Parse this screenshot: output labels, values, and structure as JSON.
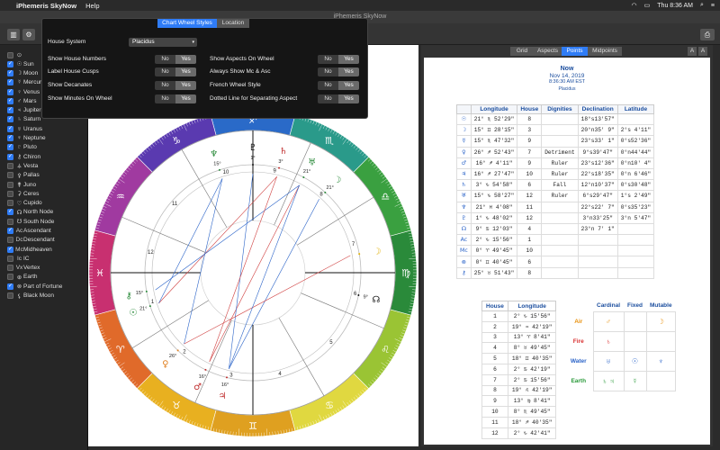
{
  "menubar": {
    "app": "iPhemeris SkyNow",
    "menu": "Help",
    "time": "Thu 8:36 AM"
  },
  "window_title": "iPhemeris SkyNow",
  "popover": {
    "tabs": [
      "Chart Wheel Styles",
      "Location"
    ],
    "house_system_label": "House System",
    "house_system_value": "Placidus",
    "left_options": [
      {
        "label": "Show House Numbers"
      },
      {
        "label": "Label House Cusps"
      },
      {
        "label": "Show Decanates"
      },
      {
        "label": "Show Minutes On Wheel"
      }
    ],
    "right_options": [
      {
        "label": "Show Aspects On Wheel"
      },
      {
        "label": "Always Show Mc & Asc"
      },
      {
        "label": "French Wheel Style"
      },
      {
        "label": "Dotted Line for Separating Aspect"
      }
    ],
    "no": "No",
    "yes": "Yes"
  },
  "sidebar": {
    "items": [
      {
        "sym": "☉",
        "label": "Sun",
        "on": true
      },
      {
        "sym": "☽",
        "label": "Moon",
        "on": true
      },
      {
        "sym": "☿",
        "label": "Mercury",
        "on": true
      },
      {
        "sym": "♀",
        "label": "Venus",
        "on": true
      },
      {
        "sym": "♂",
        "label": "Mars",
        "on": true
      },
      {
        "sym": "♃",
        "label": "Jupiter",
        "on": true
      },
      {
        "sym": "♄",
        "label": "Saturn",
        "on": true
      },
      {
        "sym": "♅",
        "label": "Uranus",
        "on": true
      },
      {
        "sym": "♆",
        "label": "Neptune",
        "on": true
      },
      {
        "sym": "♇",
        "label": "Pluto",
        "on": true
      },
      {
        "sym": "⚷",
        "label": "Chiron",
        "on": true
      },
      {
        "sym": "⚶",
        "label": "Vesta",
        "on": false
      },
      {
        "sym": "⚴",
        "label": "Pallas",
        "on": false
      },
      {
        "sym": "⚵",
        "label": "Juno",
        "on": false
      },
      {
        "sym": "⚳",
        "label": "Ceres",
        "on": false
      },
      {
        "sym": "♡",
        "label": "Cupido",
        "on": false
      },
      {
        "sym": "☊",
        "label": "North Node",
        "on": true
      },
      {
        "sym": "☋",
        "label": "South Node",
        "on": false
      },
      {
        "sym": "Ac",
        "label": "Ascendant",
        "on": true
      },
      {
        "sym": "Dc",
        "label": "Descendant",
        "on": false
      },
      {
        "sym": "Mc",
        "label": "Midheaven",
        "on": true
      },
      {
        "sym": "Ic",
        "label": "IC",
        "on": false
      },
      {
        "sym": "Vx",
        "label": "Vertex",
        "on": false
      },
      {
        "sym": "⊕",
        "label": "Earth",
        "on": false
      },
      {
        "sym": "⊗",
        "label": "Part of Fortune",
        "on": true
      },
      {
        "sym": "⚸",
        "label": "Black Moon",
        "on": false
      }
    ]
  },
  "right_tabs": [
    "Grid",
    "Aspects",
    "Points",
    "Midpoints"
  ],
  "font_buttons": [
    "A",
    "A"
  ],
  "chart_header": {
    "title": "Now",
    "date": "Nov 14, 2019",
    "time": "8:36:30 AM EST",
    "system": "Placidus"
  },
  "points_table": {
    "headers": [
      "Longitude",
      "House",
      "Dignities",
      "Declination",
      "Latitude"
    ],
    "rows": [
      {
        "g": "☉",
        "lon": "21° ♏ 52'29\"",
        "house": "8",
        "dig": "",
        "dec": "18°s13'57\"",
        "lat": ""
      },
      {
        "g": "☽",
        "lon": "15° ♊ 28'15\"",
        "house": "3",
        "dig": "",
        "dec": "20°n35' 9\"",
        "lat": "2°s 4'11\""
      },
      {
        "g": "☿",
        "lon": "15° ♏ 47'32\"",
        "house": "9",
        "dig": "",
        "dec": "23°s33' 1\"",
        "lat": "0°s52'36\""
      },
      {
        "g": "♀",
        "lon": "26° ♐ 52'43\"",
        "house": "7",
        "dig": "Detriment",
        "dec": "9°s39'47\"",
        "lat": "0°n44'44\""
      },
      {
        "g": "♂",
        "lon": "16° ♐ 4'11\"",
        "house": "9",
        "dig": "Ruler",
        "dec": "23°s12'36\"",
        "lat": "0°n10' 4\""
      },
      {
        "g": "♃",
        "lon": "16° ♐ 27'47\"",
        "house": "10",
        "dig": "Ruler",
        "dec": "22°s18'35\"",
        "lat": "0°n 6'46\""
      },
      {
        "g": "♄",
        "lon": "3° ♑ 54'58\"",
        "house": "6",
        "dig": "Fall",
        "dec": "12°n10'37\"",
        "lat": "0°s30'48\""
      },
      {
        "g": "♅",
        "lon": "15° ♑ 58'27\"",
        "house": "12",
        "dig": "Ruler",
        "dec": "6°s29'47\"",
        "lat": "1°s 2'49\""
      },
      {
        "g": "♆",
        "lon": "21° ♓ 4'08\"",
        "house": "11",
        "dig": "",
        "dec": "22°s22' 7\"",
        "lat": "0°s35'23\""
      },
      {
        "g": "♇",
        "lon": "1° ♑ 48'02\"",
        "house": "12",
        "dig": "",
        "dec": "3°n33'25\"",
        "lat": "3°n 5'47\""
      },
      {
        "g": "☊",
        "lon": "9° ♋ 12'03\"",
        "house": "4",
        "dig": "",
        "dec": "23°n 7' 1\"",
        "lat": ""
      },
      {
        "g": "Ac",
        "lon": "2° ♑ 15'56\"",
        "house": "1",
        "dig": "",
        "dec": "",
        "lat": ""
      },
      {
        "g": "Mc",
        "lon": "0° ♈ 49'45\"",
        "house": "10",
        "dig": "",
        "dec": "",
        "lat": ""
      },
      {
        "g": "⊗",
        "lon": "0° ♊ 40'45\"",
        "house": "6",
        "dig": "",
        "dec": "",
        "lat": ""
      },
      {
        "g": "⚷",
        "lon": "25° ♉ 51'43\"",
        "house": "8",
        "dig": "",
        "dec": "",
        "lat": ""
      }
    ]
  },
  "houses_table": {
    "headers": [
      "House",
      "Longitude"
    ],
    "rows": [
      {
        "n": "1",
        "lon": "2° ♑ 15'56\""
      },
      {
        "n": "2",
        "lon": "19° ♒ 42'19\""
      },
      {
        "n": "3",
        "lon": "13° ♈ 8'41\""
      },
      {
        "n": "4",
        "lon": "8° ♉ 49'45\""
      },
      {
        "n": "5",
        "lon": "18° ♊ 40'35\""
      },
      {
        "n": "6",
        "lon": "2° ♋ 42'19\""
      },
      {
        "n": "7",
        "lon": "2° ♋ 15'56\""
      },
      {
        "n": "8",
        "lon": "19° ♌ 42'19\""
      },
      {
        "n": "9",
        "lon": "13° ♍ 8'41\""
      },
      {
        "n": "10",
        "lon": "8° ♏ 49'45\""
      },
      {
        "n": "11",
        "lon": "18° ♐ 40'35\""
      },
      {
        "n": "12",
        "lon": "2° ♑ 42'41\""
      }
    ]
  },
  "elements_table": {
    "headers": [
      "Cardinal",
      "Fixed",
      "Mutable"
    ],
    "rows": [
      {
        "label": "Air",
        "color": "#e8900c",
        "cells": [
          "♂",
          "",
          "☽"
        ]
      },
      {
        "label": "Fire",
        "color": "#d93030",
        "cells": [
          "♄",
          "",
          ""
        ]
      },
      {
        "label": "Water",
        "color": "#2a63c8",
        "cells": [
          "♅",
          "☉",
          "♆"
        ]
      },
      {
        "label": "Earth",
        "color": "#2a9a3a",
        "cells": [
          "♄ ♃",
          "☿",
          ""
        ]
      }
    ]
  },
  "wheel": {
    "signs": [
      {
        "g": "♈",
        "c": "#e06a2a"
      },
      {
        "g": "♉",
        "c": "#e8b020"
      },
      {
        "g": "♊",
        "c": "#dfa020"
      },
      {
        "g": "♋",
        "c": "#e0d840"
      },
      {
        "g": "♌",
        "c": "#9ac434"
      },
      {
        "g": "♍",
        "c": "#2a8a3a"
      },
      {
        "g": "♎",
        "c": "#3aa040"
      },
      {
        "g": "♏",
        "c": "#2a9a8a"
      },
      {
        "g": "♐",
        "c": "#2a6ac8"
      },
      {
        "g": "♑",
        "c": "#5a3ab0"
      },
      {
        "g": "♒",
        "c": "#a03aa0"
      },
      {
        "g": "♓",
        "c": "#c83070"
      }
    ],
    "house_numbers": [
      "1",
      "2",
      "3",
      "4",
      "5",
      "6",
      "7",
      "8",
      "9",
      "10",
      "11",
      "12"
    ],
    "planets": [
      {
        "g": "♃",
        "deg": "16°",
        "col": "#c03030",
        "lon": 256
      },
      {
        "g": "♂",
        "deg": "16°",
        "col": "#c03030",
        "lon": 244
      },
      {
        "g": "♀",
        "deg": "26°",
        "col": "#e08020",
        "lon": 226
      },
      {
        "g": "☉",
        "deg": "21°",
        "col": "#2a8a3a",
        "lon": 198
      },
      {
        "g": "⚷",
        "deg": "15°",
        "col": "#2a8a3a",
        "lon": 190
      },
      {
        "g": "♆",
        "deg": "15°",
        "col": "#2a8a3a",
        "lon": 108
      },
      {
        "g": "♇",
        "deg": "1°",
        "col": "#111",
        "lon": 90
      },
      {
        "g": "☽",
        "deg": "21°",
        "col": "#2a8a3a",
        "lon": 48
      },
      {
        "g": "♅",
        "deg": "21°",
        "col": "#2a8a3a",
        "lon": 62
      },
      {
        "g": "♄",
        "deg": "3°",
        "col": "#c03030",
        "lon": 76
      },
      {
        "g": "☽",
        "deg": "",
        "col": "#e0b000",
        "lon": 10
      },
      {
        "g": "☊",
        "deg": "9°",
        "col": "#111",
        "lon": 348
      }
    ]
  }
}
